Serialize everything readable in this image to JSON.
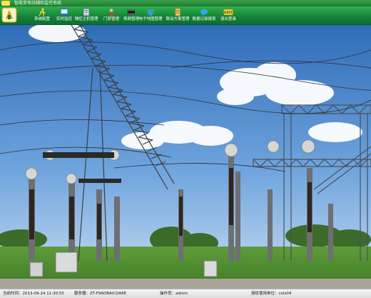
{
  "window": {
    "title": "智能变电站辅助监控系统"
  },
  "toolbar": {
    "items": [
      {
        "label": "系统配置",
        "icon": "person-run-icon"
      },
      {
        "label": "实时监控",
        "icon": "monitor-icon"
      },
      {
        "label": "辅控主机管理",
        "icon": "server-icon"
      },
      {
        "label": "门禁管理",
        "icon": "person-icon"
      },
      {
        "label": "视频管理",
        "icon": "film-icon"
      },
      {
        "label": "电子地图管理",
        "icon": "globe-icon"
      },
      {
        "label": "联动方案管理",
        "icon": "document-icon"
      },
      {
        "label": "数据记录报表",
        "icon": "chat-bubble-icon"
      },
      {
        "label": "退出登录",
        "icon": "exit-icon",
        "badge": "EXIT"
      }
    ]
  },
  "status": {
    "time_label": "当前时间：",
    "time_value": "2013-09-24 11:30:55",
    "server_label": "服务器：",
    "server_value": "ZT-F9ADBAICDA6E",
    "operator_label": "操作员：",
    "operator_value": "admin",
    "unit_label": "授权使用单位：",
    "unit_value": "csts04"
  },
  "colors": {
    "toolbar_green": "#14813a",
    "label_white": "#ffffff",
    "sky": "#4e86c8"
  }
}
